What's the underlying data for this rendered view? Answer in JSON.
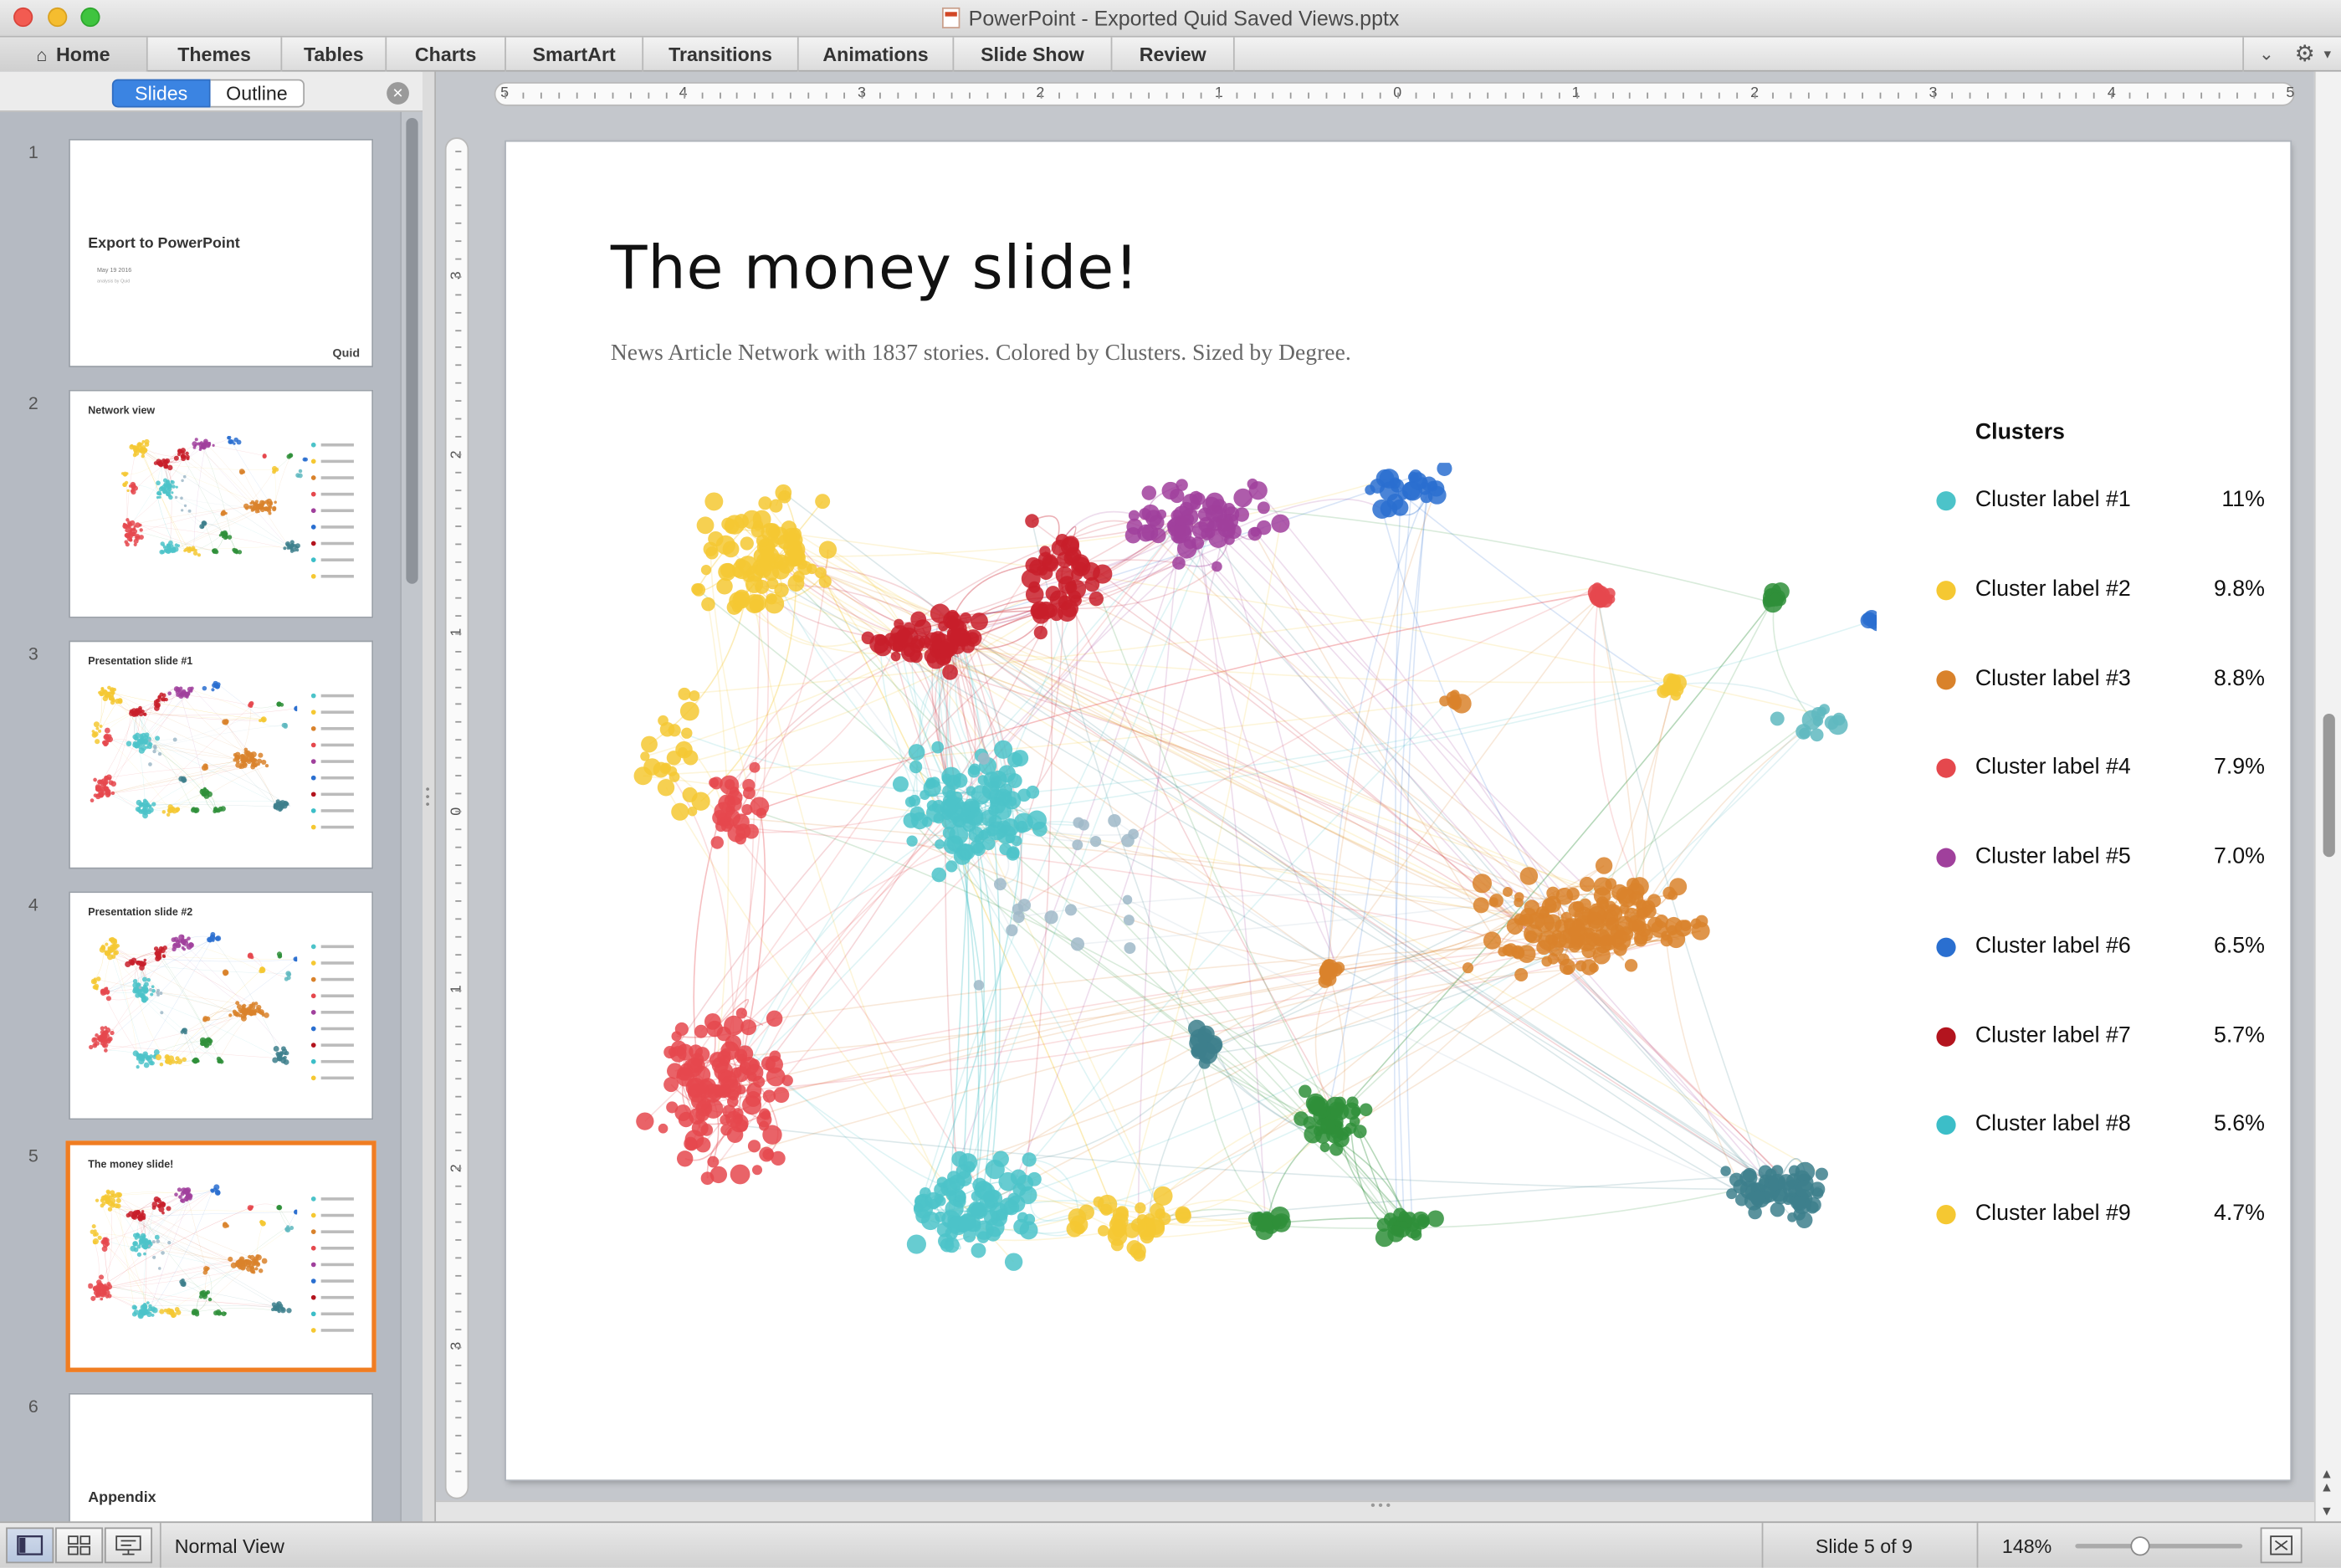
{
  "window": {
    "title": "PowerPoint - Exported Quid Saved Views.pptx",
    "traffic_lights": [
      "#f25b51",
      "#f5bd2f",
      "#3fc43f"
    ]
  },
  "ribbon": {
    "tabs": [
      {
        "label": "Home",
        "icon": "home-icon"
      },
      {
        "label": "Themes"
      },
      {
        "label": "Tables"
      },
      {
        "label": "Charts"
      },
      {
        "label": "SmartArt"
      },
      {
        "label": "Transitions"
      },
      {
        "label": "Animations"
      },
      {
        "label": "Slide Show"
      },
      {
        "label": "Review"
      }
    ],
    "collapse_icon": "chevron-down-icon",
    "settings_icon": "gear-icon"
  },
  "sidebar": {
    "segments": {
      "slides": "Slides",
      "outline": "Outline",
      "active": "slides"
    },
    "close_icon": "close-icon",
    "thumbnails": [
      {
        "number": "1",
        "title": "Export to PowerPoint",
        "subtitle": "May 19 2016",
        "note": "analysis by Quid",
        "brand": "Quid"
      },
      {
        "number": "2",
        "title": "Network view"
      },
      {
        "number": "3",
        "title": "Presentation slide #1"
      },
      {
        "number": "4",
        "title": "Presentation slide #2"
      },
      {
        "number": "5",
        "title": "The money slide!",
        "selected": true
      },
      {
        "number": "6",
        "title": "Appendix"
      }
    ]
  },
  "rulers": {
    "horizontal": [
      "5",
      "4",
      "3",
      "2",
      "1",
      "0",
      "1",
      "2",
      "3",
      "4",
      "5"
    ],
    "vertical": [
      "3",
      "2",
      "1",
      "0",
      "1",
      "2",
      "3"
    ]
  },
  "slide": {
    "title": "The money slide!",
    "subtitle": "News Article Network with 1837 stories. Colored by Clusters. Sized by Degree.",
    "legend": {
      "title": "Clusters",
      "items": [
        {
          "label": "Cluster label #1",
          "pct": "11%",
          "color": "#4cc3c9"
        },
        {
          "label": "Cluster label #2",
          "pct": "9.8%",
          "color": "#f5c832"
        },
        {
          "label": "Cluster label #3",
          "pct": "8.8%",
          "color": "#d9822b"
        },
        {
          "label": "Cluster label #4",
          "pct": "7.9%",
          "color": "#e5484d"
        },
        {
          "label": "Cluster label #5",
          "pct": "7.0%",
          "color": "#a0409c"
        },
        {
          "label": "Cluster label #6",
          "pct": "6.5%",
          "color": "#2a6fd0"
        },
        {
          "label": "Cluster label #7",
          "pct": "5.7%",
          "color": "#b3141e"
        },
        {
          "label": "Cluster label #8",
          "pct": "5.6%",
          "color": "#3cbec8"
        },
        {
          "label": "Cluster label #9",
          "pct": "4.7%",
          "color": "#f5c832"
        }
      ]
    }
  },
  "status": {
    "view_buttons": [
      "normal-view-icon",
      "slide-sorter-icon",
      "presenter-icon"
    ],
    "view_label": "Normal View",
    "slide_counter": "Slide 5 of 9",
    "zoom": "148%",
    "zoom_level": 0.38,
    "fit_icon": "fit-window-icon"
  }
}
